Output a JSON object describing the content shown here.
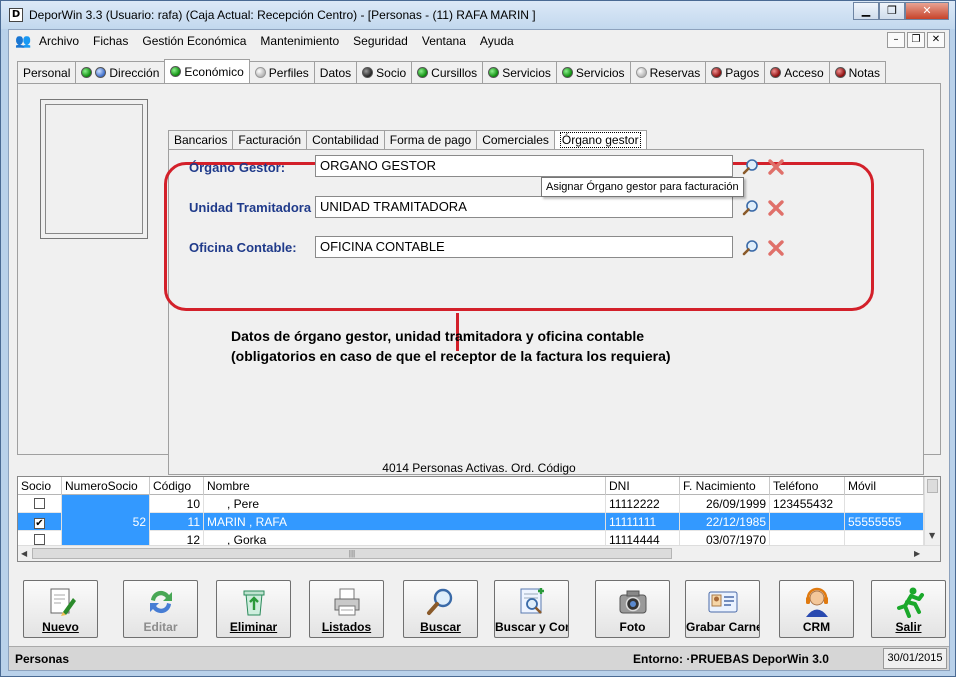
{
  "window": {
    "title": "DeporWin 3.3  (Usuario: rafa)  (Caja Actual: Recepción Centro) - [Personas - (11) RAFA MARIN ]",
    "app_icon_letter": "D"
  },
  "menu": {
    "items": [
      {
        "label": "Archivo"
      },
      {
        "label": "Fichas"
      },
      {
        "label": "Gestión Económica"
      },
      {
        "label": "Mantenimiento"
      },
      {
        "label": "Seguridad"
      },
      {
        "label": "Ventana"
      },
      {
        "label": "Ayuda"
      }
    ]
  },
  "main_tabs": [
    {
      "label": "Personal",
      "dots": []
    },
    {
      "label": "Dirección",
      "dots": [
        "green",
        "blue"
      ]
    },
    {
      "label": "Económico",
      "dots": [
        "green"
      ],
      "active": true
    },
    {
      "label": "Perfiles",
      "dots": [
        "gray"
      ]
    },
    {
      "label": "Datos",
      "dots": []
    },
    {
      "label": "Socio",
      "dots": [
        "dark"
      ]
    },
    {
      "label": "Cursillos",
      "dots": [
        "green"
      ]
    },
    {
      "label": "Servicios",
      "dots": [
        "green"
      ]
    },
    {
      "label": "Servicios",
      "dots": [
        "green"
      ]
    },
    {
      "label": "Reservas",
      "dots": [
        "gray"
      ]
    },
    {
      "label": "Pagos",
      "dots": [
        "red"
      ]
    },
    {
      "label": "Acceso",
      "dots": [
        "red"
      ]
    },
    {
      "label": "Notas",
      "dots": [
        "red"
      ]
    }
  ],
  "sub_tabs": [
    {
      "label": "Bancarios"
    },
    {
      "label": "Facturación"
    },
    {
      "label": "Contabilidad"
    },
    {
      "label": "Forma de pago"
    },
    {
      "label": "Comerciales"
    },
    {
      "label": "Órgano gestor",
      "active": true
    }
  ],
  "fields": {
    "organo_gestor": {
      "label": "Órgano Gestor:",
      "value": "ORGANO GESTOR"
    },
    "unidad_tramitadora": {
      "label": "Unidad Tramitadora",
      "value": "UNIDAD TRAMITADORA"
    },
    "oficina_contable": {
      "label": "Oficina Contable:",
      "value": "OFICINA CONTABLE"
    }
  },
  "tooltip": "Asignar Órgano gestor para facturación",
  "annotation": {
    "line1": "Datos de órgano gestor, unidad tramitadora y oficina contable",
    "line2": "(obligatorios en caso de que el receptor de la factura los requiera)"
  },
  "grid": {
    "caption": "4014 Personas Activas. Ord. Código",
    "columns": [
      "Socio",
      "NumeroSocio",
      "Código",
      "Nombre",
      "DNI",
      "F. Nacimiento",
      "Teléfono",
      "Móvil"
    ],
    "rows": [
      {
        "socio": "",
        "numero_socio": "",
        "codigo": "10",
        "nombre": "      , Pere",
        "dni": "11112222",
        "nacimiento": "26/09/1999",
        "telefono": "123455432",
        "movil": ""
      },
      {
        "socio": "✔",
        "numero_socio": "52",
        "codigo": "11",
        "nombre": "MARIN , RAFA",
        "dni": "11111111",
        "nacimiento": "22/12/1985",
        "telefono": "",
        "movil": "55555555",
        "selected": true
      },
      {
        "socio": "",
        "numero_socio": "",
        "codigo": "12",
        "nombre": "      , Gorka",
        "dni": "11114444",
        "nacimiento": "03/07/1970",
        "telefono": "",
        "movil": ""
      }
    ]
  },
  "toolbar": {
    "buttons": [
      {
        "label": "Nuevo",
        "icon": "new-document-icon",
        "enabled": true
      },
      {
        "label": "Editar",
        "icon": "refresh-arrows-icon",
        "enabled": false
      },
      {
        "label": "Eliminar",
        "icon": "recycle-bin-icon",
        "enabled": true
      },
      {
        "label": "Listados",
        "icon": "printer-icon",
        "enabled": true
      },
      {
        "label": "Buscar",
        "icon": "magnifier-icon",
        "enabled": true
      },
      {
        "label": "Buscar y Contr",
        "icon": "search-document-icon",
        "enabled": true
      },
      {
        "label": "Foto",
        "icon": "camera-icon",
        "enabled": true
      },
      {
        "label": "Grabar Carnet",
        "icon": "id-card-icon",
        "enabled": true
      },
      {
        "label": "CRM",
        "icon": "headset-person-icon",
        "enabled": true
      },
      {
        "label": "Salir",
        "icon": "running-man-icon",
        "enabled": true
      }
    ]
  },
  "status": {
    "left": "Personas",
    "entorno": "Entorno: ·PRUEBAS DeporWin 3.0",
    "date": "30/01/2015"
  },
  "colors": {
    "annotation_red": "#d3202a",
    "label_blue": "#1f3a8a",
    "selection_blue": "#3399ff"
  }
}
